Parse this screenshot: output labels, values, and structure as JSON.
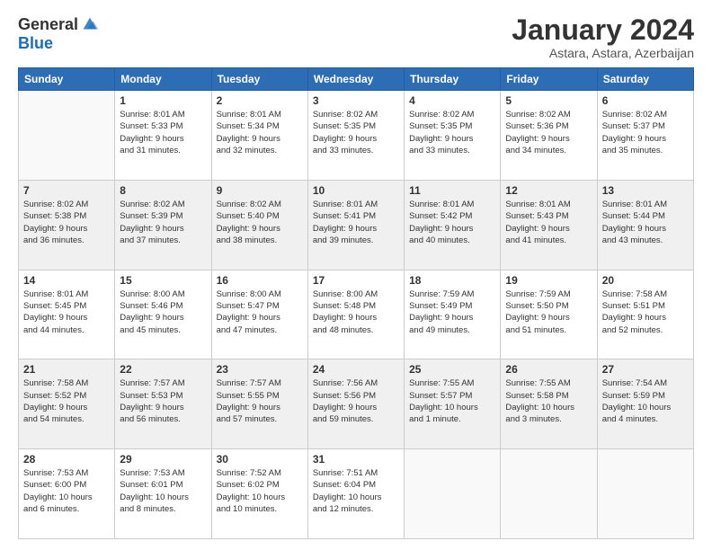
{
  "logo": {
    "general": "General",
    "blue": "Blue"
  },
  "title": "January 2024",
  "location": "Astara, Astara, Azerbaijan",
  "days_header": [
    "Sunday",
    "Monday",
    "Tuesday",
    "Wednesday",
    "Thursday",
    "Friday",
    "Saturday"
  ],
  "weeks": [
    [
      {
        "day": "",
        "info": ""
      },
      {
        "day": "1",
        "info": "Sunrise: 8:01 AM\nSunset: 5:33 PM\nDaylight: 9 hours\nand 31 minutes."
      },
      {
        "day": "2",
        "info": "Sunrise: 8:01 AM\nSunset: 5:34 PM\nDaylight: 9 hours\nand 32 minutes."
      },
      {
        "day": "3",
        "info": "Sunrise: 8:02 AM\nSunset: 5:35 PM\nDaylight: 9 hours\nand 33 minutes."
      },
      {
        "day": "4",
        "info": "Sunrise: 8:02 AM\nSunset: 5:35 PM\nDaylight: 9 hours\nand 33 minutes."
      },
      {
        "day": "5",
        "info": "Sunrise: 8:02 AM\nSunset: 5:36 PM\nDaylight: 9 hours\nand 34 minutes."
      },
      {
        "day": "6",
        "info": "Sunrise: 8:02 AM\nSunset: 5:37 PM\nDaylight: 9 hours\nand 35 minutes."
      }
    ],
    [
      {
        "day": "7",
        "info": "Sunrise: 8:02 AM\nSunset: 5:38 PM\nDaylight: 9 hours\nand 36 minutes."
      },
      {
        "day": "8",
        "info": "Sunrise: 8:02 AM\nSunset: 5:39 PM\nDaylight: 9 hours\nand 37 minutes."
      },
      {
        "day": "9",
        "info": "Sunrise: 8:02 AM\nSunset: 5:40 PM\nDaylight: 9 hours\nand 38 minutes."
      },
      {
        "day": "10",
        "info": "Sunrise: 8:01 AM\nSunset: 5:41 PM\nDaylight: 9 hours\nand 39 minutes."
      },
      {
        "day": "11",
        "info": "Sunrise: 8:01 AM\nSunset: 5:42 PM\nDaylight: 9 hours\nand 40 minutes."
      },
      {
        "day": "12",
        "info": "Sunrise: 8:01 AM\nSunset: 5:43 PM\nDaylight: 9 hours\nand 41 minutes."
      },
      {
        "day": "13",
        "info": "Sunrise: 8:01 AM\nSunset: 5:44 PM\nDaylight: 9 hours\nand 43 minutes."
      }
    ],
    [
      {
        "day": "14",
        "info": "Sunrise: 8:01 AM\nSunset: 5:45 PM\nDaylight: 9 hours\nand 44 minutes."
      },
      {
        "day": "15",
        "info": "Sunrise: 8:00 AM\nSunset: 5:46 PM\nDaylight: 9 hours\nand 45 minutes."
      },
      {
        "day": "16",
        "info": "Sunrise: 8:00 AM\nSunset: 5:47 PM\nDaylight: 9 hours\nand 47 minutes."
      },
      {
        "day": "17",
        "info": "Sunrise: 8:00 AM\nSunset: 5:48 PM\nDaylight: 9 hours\nand 48 minutes."
      },
      {
        "day": "18",
        "info": "Sunrise: 7:59 AM\nSunset: 5:49 PM\nDaylight: 9 hours\nand 49 minutes."
      },
      {
        "day": "19",
        "info": "Sunrise: 7:59 AM\nSunset: 5:50 PM\nDaylight: 9 hours\nand 51 minutes."
      },
      {
        "day": "20",
        "info": "Sunrise: 7:58 AM\nSunset: 5:51 PM\nDaylight: 9 hours\nand 52 minutes."
      }
    ],
    [
      {
        "day": "21",
        "info": "Sunrise: 7:58 AM\nSunset: 5:52 PM\nDaylight: 9 hours\nand 54 minutes."
      },
      {
        "day": "22",
        "info": "Sunrise: 7:57 AM\nSunset: 5:53 PM\nDaylight: 9 hours\nand 56 minutes."
      },
      {
        "day": "23",
        "info": "Sunrise: 7:57 AM\nSunset: 5:55 PM\nDaylight: 9 hours\nand 57 minutes."
      },
      {
        "day": "24",
        "info": "Sunrise: 7:56 AM\nSunset: 5:56 PM\nDaylight: 9 hours\nand 59 minutes."
      },
      {
        "day": "25",
        "info": "Sunrise: 7:55 AM\nSunset: 5:57 PM\nDaylight: 10 hours\nand 1 minute."
      },
      {
        "day": "26",
        "info": "Sunrise: 7:55 AM\nSunset: 5:58 PM\nDaylight: 10 hours\nand 3 minutes."
      },
      {
        "day": "27",
        "info": "Sunrise: 7:54 AM\nSunset: 5:59 PM\nDaylight: 10 hours\nand 4 minutes."
      }
    ],
    [
      {
        "day": "28",
        "info": "Sunrise: 7:53 AM\nSunset: 6:00 PM\nDaylight: 10 hours\nand 6 minutes."
      },
      {
        "day": "29",
        "info": "Sunrise: 7:53 AM\nSunset: 6:01 PM\nDaylight: 10 hours\nand 8 minutes."
      },
      {
        "day": "30",
        "info": "Sunrise: 7:52 AM\nSunset: 6:02 PM\nDaylight: 10 hours\nand 10 minutes."
      },
      {
        "day": "31",
        "info": "Sunrise: 7:51 AM\nSunset: 6:04 PM\nDaylight: 10 hours\nand 12 minutes."
      },
      {
        "day": "",
        "info": ""
      },
      {
        "day": "",
        "info": ""
      },
      {
        "day": "",
        "info": ""
      }
    ]
  ]
}
